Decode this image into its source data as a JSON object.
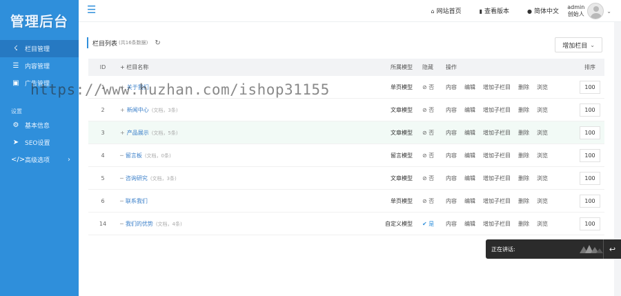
{
  "logo": "管理后台",
  "sidebar": {
    "items": [
      {
        "label": "栏目管理",
        "icon": "sitemap-icon",
        "active": true
      },
      {
        "label": "内容管理",
        "icon": "list-icon",
        "active": false
      },
      {
        "label": "广告管理",
        "icon": "image-icon",
        "active": false
      }
    ],
    "section": "设置",
    "settings": [
      {
        "label": "基本信息",
        "icon": "gear-icon"
      },
      {
        "label": "SEO设置",
        "icon": "send-icon"
      },
      {
        "label": "高级选项",
        "icon": "code-icon"
      }
    ]
  },
  "topbar": {
    "home": "网站首页",
    "version": "查看版本",
    "lang": "简体中文",
    "user_name": "admin",
    "user_role": "创始人"
  },
  "panel": {
    "title": "栏目列表",
    "count": "(共16条数据)",
    "add_button": "增加栏目"
  },
  "table": {
    "headers": {
      "id": "ID",
      "name": "+ 栏目名称",
      "model": "所属模型",
      "hidden": "隐藏",
      "ops": "操作",
      "sort": "排序"
    },
    "ops": [
      "内容",
      "编辑",
      "增加子栏目",
      "删除",
      "浏览"
    ],
    "rows": [
      {
        "id": "1",
        "prefix": "+",
        "name": "关于我们",
        "meta": "",
        "model": "单页模型",
        "hidden": "否",
        "sort": "100"
      },
      {
        "id": "2",
        "prefix": "+",
        "name": "新闻中心",
        "meta": "(文档，3条)",
        "model": "文章模型",
        "hidden": "否",
        "sort": "100"
      },
      {
        "id": "3",
        "prefix": "+",
        "name": "产品展示",
        "meta": "(文档，5条)",
        "model": "文章模型",
        "hidden": "否",
        "sort": "100"
      },
      {
        "id": "4",
        "prefix": "─",
        "name": "留言板",
        "meta": "(文档，0条)",
        "model": "留言模型",
        "hidden": "否",
        "sort": "100"
      },
      {
        "id": "5",
        "prefix": "─",
        "name": "咨询研究",
        "meta": "(文档，3条)",
        "model": "文章模型",
        "hidden": "否",
        "sort": "100"
      },
      {
        "id": "6",
        "prefix": "─",
        "name": "联系我们",
        "meta": "",
        "model": "单页模型",
        "hidden": "否",
        "sort": "100"
      },
      {
        "id": "14",
        "prefix": "─",
        "name": "我们的优势",
        "meta": "(文档，4条)",
        "model": "自定义模型",
        "hidden": "是",
        "sort": "100"
      }
    ]
  },
  "watermark": "https://www.huzhan.com/ishop31155",
  "chat": {
    "label": "正在讲话:"
  }
}
